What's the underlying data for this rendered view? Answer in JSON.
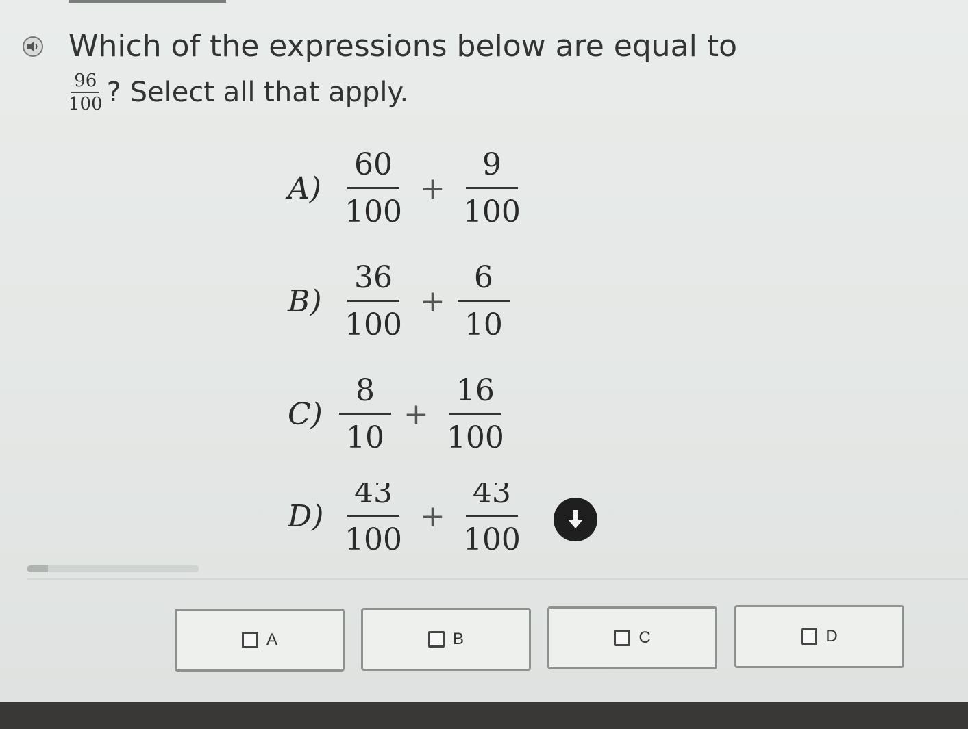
{
  "question": {
    "line1": "Which of the expressions below are equal to",
    "fraction": {
      "num": "96",
      "den": "100"
    },
    "line2_suffix": "? Select all that apply."
  },
  "choices": [
    {
      "letter": "A)",
      "a": {
        "num": "60",
        "den": "100"
      },
      "op": "+",
      "b": {
        "num": "9",
        "den": "100"
      }
    },
    {
      "letter": "B)",
      "a": {
        "num": "36",
        "den": "100"
      },
      "op": "+",
      "b": {
        "num": "6",
        "den": "10"
      }
    },
    {
      "letter": "C)",
      "a": {
        "num": "8",
        "den": "10"
      },
      "op": "+",
      "b": {
        "num": "16",
        "den": "100"
      }
    },
    {
      "letter": "D)",
      "a": {
        "num": "43",
        "den": "100"
      },
      "op": "+",
      "b": {
        "num": "43",
        "den": "100"
      }
    }
  ],
  "answers": [
    "A",
    "B",
    "C",
    "D"
  ],
  "icons": {
    "speaker": "speaker-icon",
    "scroll": "arrow-down-icon"
  }
}
